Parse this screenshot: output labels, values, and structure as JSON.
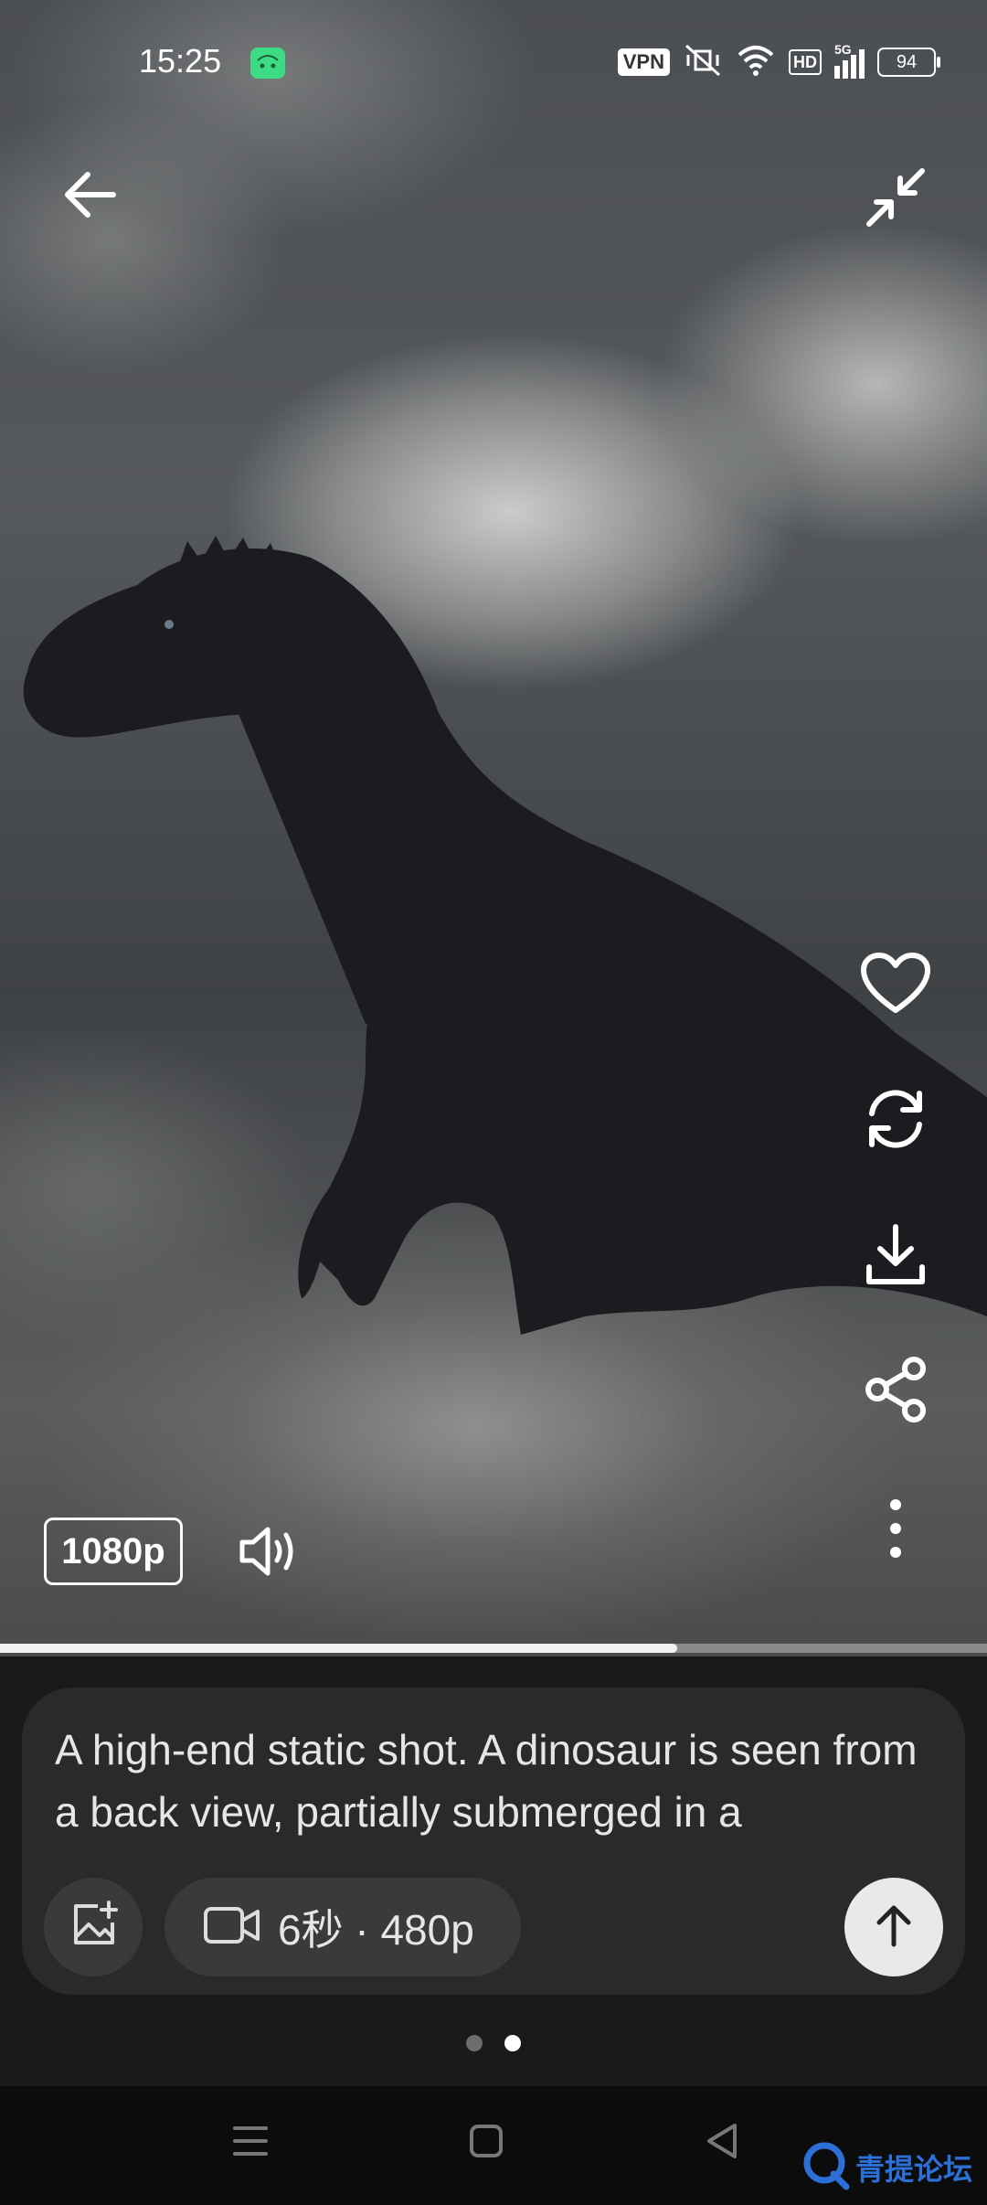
{
  "status_bar": {
    "time": "15:25",
    "vpn_label": "VPN",
    "hd_label": "HD",
    "network_label": "5G",
    "battery_level": "94",
    "icons": [
      "android-icon",
      "vpn-badge",
      "mute-vibrate-icon",
      "wifi-icon",
      "hd-badge",
      "signal-icon",
      "battery-icon"
    ]
  },
  "header": {
    "back_icon": "arrow-left-icon",
    "exit_fullscreen_icon": "collapse-icon"
  },
  "side_actions": [
    {
      "name": "like",
      "icon": "heart-icon"
    },
    {
      "name": "regenerate",
      "icon": "refresh-icon"
    },
    {
      "name": "download",
      "icon": "download-icon"
    },
    {
      "name": "share",
      "icon": "share-icon"
    },
    {
      "name": "more",
      "icon": "more-vertical-icon"
    }
  ],
  "player": {
    "quality": "1080p",
    "volume_icon": "speaker-icon",
    "progress": 0.686
  },
  "prompt": {
    "text": "A high-end static shot. A dinosaur is seen from a back view, partially submerged in a",
    "add_image_icon": "image-plus-icon",
    "video_settings_icon": "video-camera-icon",
    "video_settings_label": "6秒 · 480p",
    "submit_icon": "arrow-up-icon"
  },
  "pagination": {
    "count": 2,
    "active_index": 1
  },
  "nav_bar": {
    "icons": [
      "menu-icon",
      "home-square-icon",
      "back-triangle-icon"
    ]
  },
  "watermark": {
    "text": "青提论坛"
  },
  "colors": {
    "card_bg": "#2a2a2c",
    "chip_bg": "#3a3a3c",
    "submit_bg": "#e9e9e9",
    "watermark": "#2c6fd6"
  }
}
